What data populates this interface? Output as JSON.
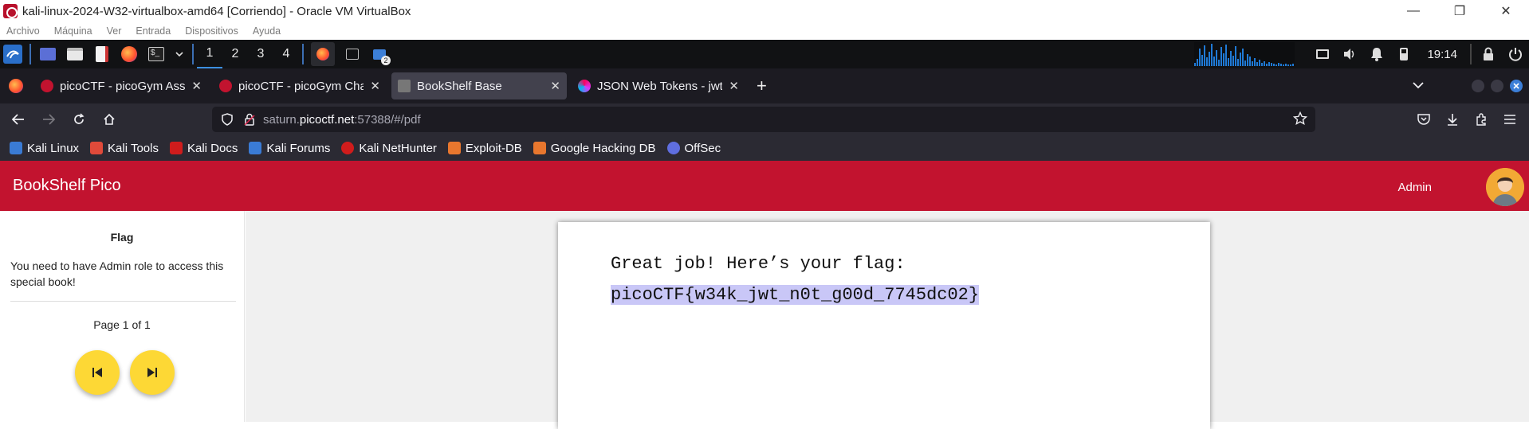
{
  "window": {
    "title": "kali-linux-2024-W32-virtualbox-amd64 [Corriendo] - Oracle VM VirtualBox",
    "controls": {
      "minimize": "—",
      "restore": "❐",
      "close": "✕"
    }
  },
  "vbox_menu": [
    "Archivo",
    "Máquina",
    "Ver",
    "Entrada",
    "Dispositivos",
    "Ayuda"
  ],
  "kali_panel": {
    "workspaces": [
      "1",
      "2",
      "3",
      "4"
    ],
    "active_workspace": "1",
    "clock": "19:14",
    "notification_badge": "2"
  },
  "tabs": [
    {
      "title": "picoCTF - picoGym Assig",
      "favicon_color": "#c2132f",
      "active": false
    },
    {
      "title": "picoCTF - picoGym Challe",
      "favicon_color": "#c2132f",
      "active": false
    },
    {
      "title": "BookShelf Base",
      "favicon_color": "#888888",
      "active": true
    },
    {
      "title": "JSON Web Tokens - jwt.io",
      "favicon_color": "#d63aff",
      "active": false
    }
  ],
  "tab_close": "✕",
  "new_tab": "+",
  "url": {
    "prefix": "saturn.",
    "domain": "picoctf.net",
    "suffix": ":57388/#/pdf"
  },
  "bookmarks": [
    {
      "label": "Kali Linux",
      "color": "#3a7bd5"
    },
    {
      "label": "Kali Tools",
      "color": "#e04a3a"
    },
    {
      "label": "Kali Docs",
      "color": "#d01c1c"
    },
    {
      "label": "Kali Forums",
      "color": "#3a7bd5"
    },
    {
      "label": "Kali NetHunter",
      "color": "#d01c1c"
    },
    {
      "label": "Exploit-DB",
      "color": "#e8772e"
    },
    {
      "label": "Google Hacking DB",
      "color": "#e8772e"
    },
    {
      "label": "OffSec",
      "color": "#5f6ee0"
    }
  ],
  "app": {
    "title": "BookShelf Pico",
    "admin_button": "Admin",
    "brand_color": "#c2132f"
  },
  "sidebar": {
    "title": "Flag",
    "message": "You need to have Admin role to access this special book!",
    "page_info": "Page 1 of 1"
  },
  "pdf": {
    "line1": "Great job! Here’s your flag:",
    "flag": "picoCTF{w34k_jwt_n0t_g00d_7745dc02}"
  }
}
